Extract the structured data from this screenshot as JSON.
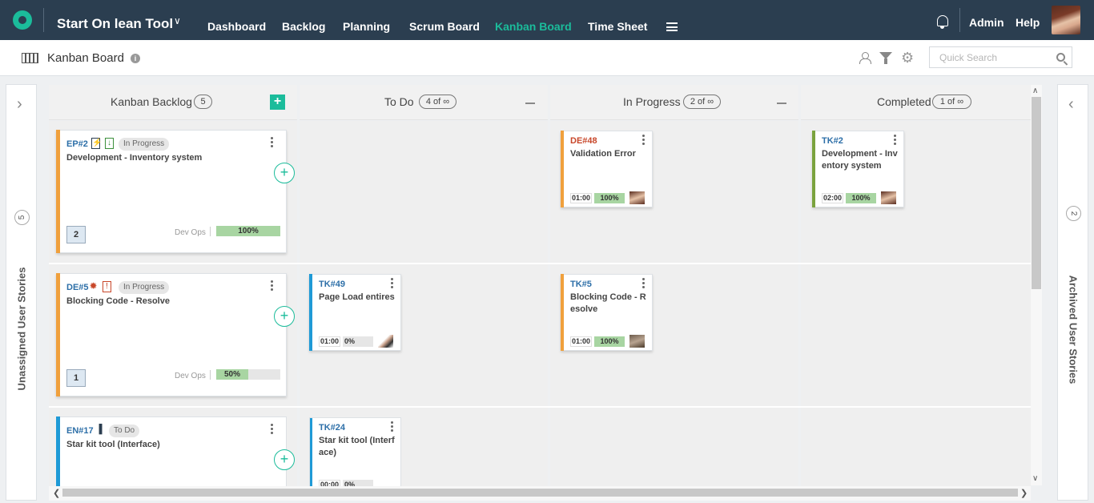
{
  "header": {
    "app_title": "Start On lean Tool",
    "nav": [
      "Dashboard",
      "Backlog",
      "Planning",
      "Scrum Board",
      "Kanban Board",
      "Time Sheet"
    ],
    "active_nav": "Kanban Board",
    "admin": "Admin",
    "help": "Help"
  },
  "subbar": {
    "page_title": "Kanban Board",
    "search_placeholder": "Quick Search"
  },
  "left_panel": {
    "label": "Unassigned User Stories",
    "count": "5"
  },
  "right_panel": {
    "label": "Archived User Stories",
    "count": "2"
  },
  "columns": [
    {
      "title": "Kanban Backlog",
      "count": "5"
    },
    {
      "title": "To Do",
      "count": "4 of ∞"
    },
    {
      "title": "In Progress",
      "count": "2 of ∞"
    },
    {
      "title": "Completed",
      "count": "1 of ∞"
    }
  ],
  "stories": [
    {
      "id": "EP#2",
      "status": "In Progress",
      "title": "Development - Inventory system",
      "count": "2",
      "team": "Dev Ops",
      "progress": 100,
      "progress_label": "100%",
      "color": "#f0a03c",
      "id_color": "#2d6fa8"
    },
    {
      "id": "DE#5",
      "status": "In Progress",
      "title": "Blocking Code - Resolve",
      "count": "1",
      "team": "Dev Ops",
      "progress": 50,
      "progress_label": "50%",
      "color": "#f0a03c",
      "id_color": "#2d6fa8"
    },
    {
      "id": "EN#17",
      "status": "To Do",
      "title": "Star kit tool (Interface)",
      "color": "#1f9ad6",
      "id_color": "#2d6fa8"
    }
  ],
  "tasks": [
    {
      "id": "DE#48",
      "title": "Validation Error",
      "time": "01:00",
      "progress": 100,
      "progress_label": "100%",
      "color": "#f0a03c",
      "id_color": "#c8472a"
    },
    {
      "id": "TK#2",
      "title": "Development - Inventory system",
      "time": "02:00",
      "progress": 100,
      "progress_label": "100%",
      "color": "#7ba33e",
      "id_color": "#2d6fa8"
    },
    {
      "id": "TK#49",
      "title": "Page Load entires",
      "time": "01:00",
      "progress": 0,
      "progress_label": "0%",
      "color": "#1f9ad6",
      "id_color": "#2d6fa8"
    },
    {
      "id": "TK#5",
      "title": "Blocking Code - Resolve",
      "time": "01:00",
      "progress": 100,
      "progress_label": "100%",
      "color": "#f0a03c",
      "id_color": "#2d6fa8"
    },
    {
      "id": "TK#24",
      "title": "Star kit tool (Interface)",
      "time": "00:00",
      "progress": 0,
      "progress_label": "0%",
      "color": "#1f9ad6",
      "id_color": "#2d6fa8"
    }
  ],
  "colors": {
    "header_bg": "#2b3e50",
    "accent": "#1bbc9b"
  }
}
